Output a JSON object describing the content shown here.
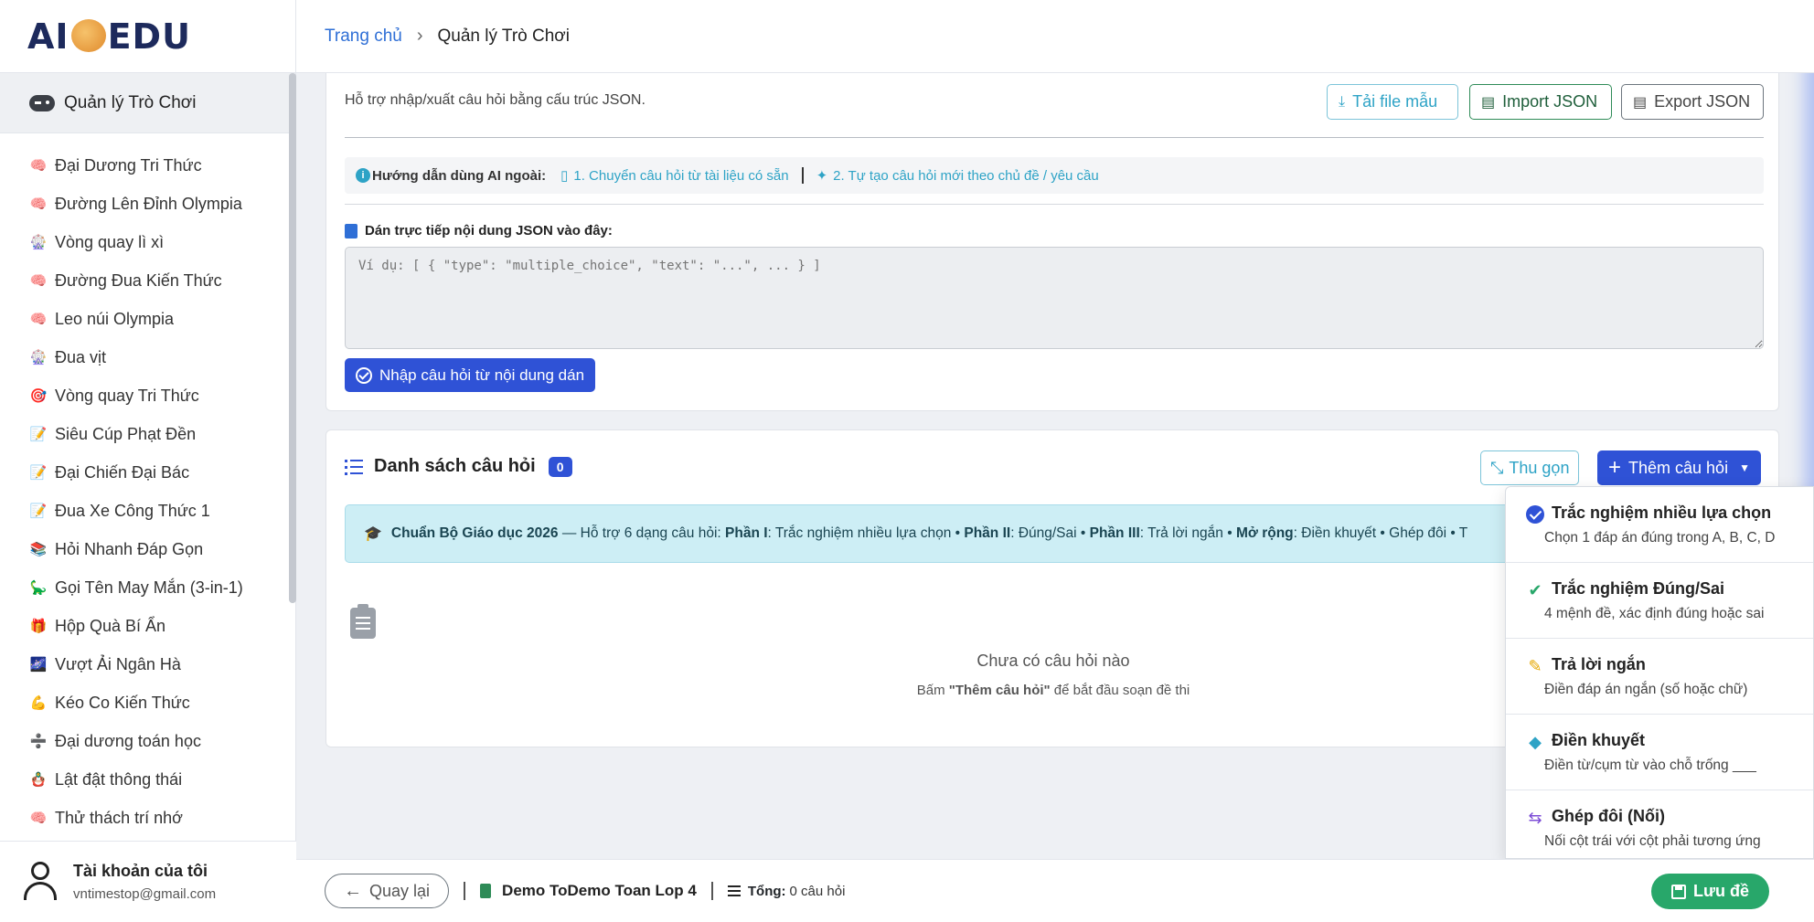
{
  "logo": {
    "text_left": "AI",
    "text_right": "EDU"
  },
  "header": {
    "breadcrumb_home": "Trang chủ",
    "breadcrumb_current": "Quản lý Trò Chơi"
  },
  "sidebar": {
    "active_label": "Quản lý Trò Chơi",
    "items": [
      {
        "icon": "🧠",
        "label": "Đại Dương Tri Thức"
      },
      {
        "icon": "🧠",
        "label": "Đường Lên Đỉnh Olympia"
      },
      {
        "icon": "🎡",
        "label": "Vòng quay lì xì"
      },
      {
        "icon": "🧠",
        "label": "Đường Đua Kiến Thức"
      },
      {
        "icon": "🧠",
        "label": "Leo núi Olympia"
      },
      {
        "icon": "🎡",
        "label": "Đua vịt"
      },
      {
        "icon": "🎯",
        "label": "Vòng quay Tri Thức"
      },
      {
        "icon": "📝",
        "label": "Siêu Cúp Phạt Đền"
      },
      {
        "icon": "📝",
        "label": "Đại Chiến Đại Bác"
      },
      {
        "icon": "📝",
        "label": "Đua Xe Công Thức 1"
      },
      {
        "icon": "📚",
        "label": "Hỏi Nhanh Đáp Gọn"
      },
      {
        "icon": "🦕",
        "label": "Gọi Tên May Mắn (3-in-1)"
      },
      {
        "icon": "🎁",
        "label": "Hộp Quà Bí Ẩn"
      },
      {
        "icon": "🌌",
        "label": "Vượt Ải Ngân Hà"
      },
      {
        "icon": "💪",
        "label": "Kéo Co Kiến Thức"
      },
      {
        "icon": "➗",
        "label": "Đại dương toán học"
      },
      {
        "icon": "🪆",
        "label": "Lật đật thông thái"
      },
      {
        "icon": "🧠",
        "label": "Thử thách trí nhớ"
      }
    ],
    "account_name": "Tài khoản của tôi",
    "account_email": "vntimestop@gmail.com"
  },
  "import_card": {
    "description": "Hỗ trợ nhập/xuất câu hỏi bằng cấu trúc JSON.",
    "sample_button": "Tải file mẫu",
    "import_button": "Import JSON",
    "export_button": "Export JSON",
    "guide_label": "Hướng dẫn dùng AI ngoài:",
    "guide_link_1": "1. Chuyển câu hỏi từ tài liệu có sẵn",
    "guide_link_2": "2. Tự tạo câu hỏi mới theo chủ đề / yêu cầu",
    "paste_label": "Dán trực tiếp nội dung JSON vào đây:",
    "paste_placeholder": "Ví dụ: [ { \"type\": \"multiple_choice\", \"text\": \"...\", ... } ]",
    "paste_button": "Nhập câu hỏi từ nội dung dán"
  },
  "questions_card": {
    "title": "Danh sách câu hỏi",
    "count": "0",
    "collapse_button": "Thu gọn",
    "add_button": "Thêm câu hỏi",
    "notice": {
      "strong": "Chuẩn Bộ Giáo dục 2026",
      "text_1": " — Hỗ trợ 6 dạng câu hỏi: ",
      "p1_label": "Phần I",
      "p1_text": ": Trắc nghiệm nhiều lựa chọn • ",
      "p2_label": "Phần II",
      "p2_text": ": Đúng/Sai • ",
      "p3_label": "Phần III",
      "p3_text": ": Trả lời ngắn • ",
      "ext_label": "Mở rộng",
      "ext_text": ": Điền khuyết • Ghép đôi • T"
    },
    "empty_title": "Chưa có câu hỏi nào",
    "empty_sub_1": "Bấm ",
    "empty_sub_strong": "\"Thêm câu hỏi\"",
    "empty_sub_2": " để bắt đầu soạn đề thi"
  },
  "dropdown": {
    "items": [
      {
        "title": "Trắc nghiệm nhiều lựa chọn",
        "desc": "Chọn 1 đáp án đúng trong A, B, C, D",
        "color": "#2f52d6"
      },
      {
        "title": "Trắc nghiệm Đúng/Sai",
        "desc": "4 mệnh đề, xác định đúng hoặc sai",
        "color": "#28a76a"
      },
      {
        "title": "Trả lời ngắn",
        "desc": "Điền đáp án ngắn (số hoặc chữ)",
        "color": "#e6a700"
      },
      {
        "title": "Điền khuyết",
        "desc": "Điền từ/cụm từ vào chỗ trống ___",
        "color": "#2ea3c6"
      },
      {
        "title": "Ghép đôi (Nối)",
        "desc": "Nối cột trái với cột phải tương ứng",
        "color": "#7b4bd6"
      }
    ]
  },
  "footer": {
    "back_button": "Quay lại",
    "doc_name": "Demo ToDemo Toan Lop 4",
    "total_label": "Tổng:",
    "total_value": "0 câu hỏi",
    "save_button": "Lưu đề"
  },
  "colors": {
    "primary": "#2f52d6",
    "info": "#2ea3c6",
    "success": "#28a76a"
  }
}
